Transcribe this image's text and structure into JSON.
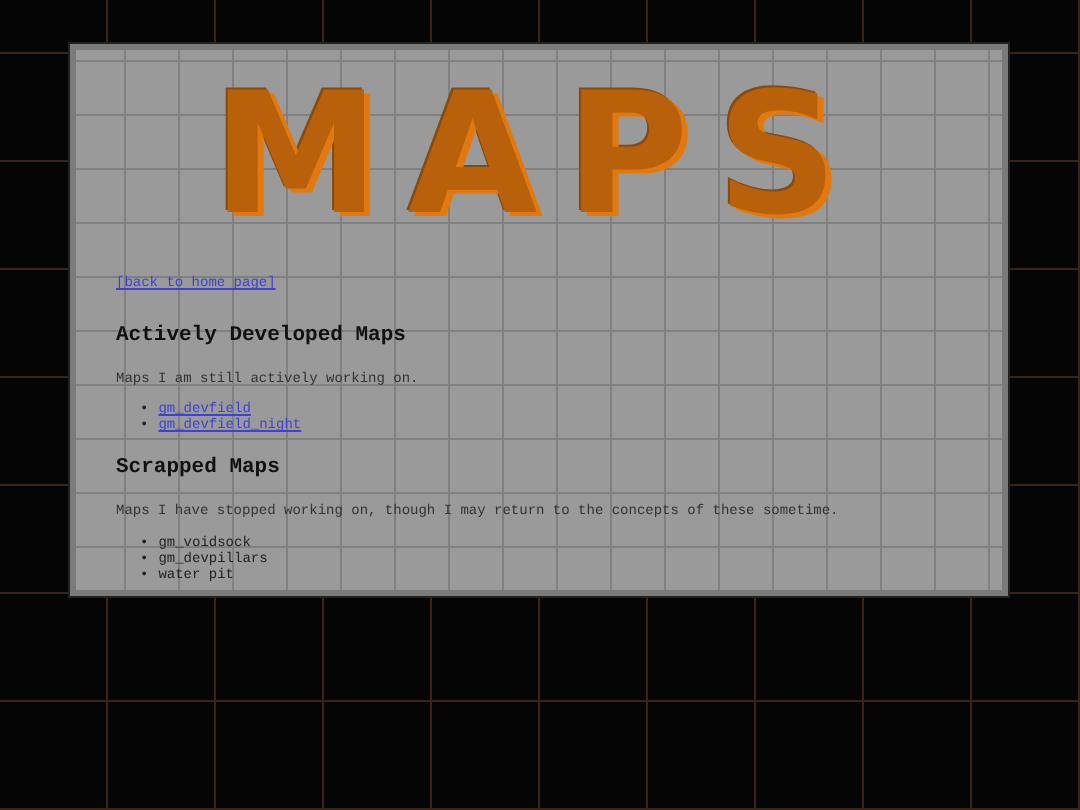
{
  "logo": "MAPS",
  "back_link": "[back to home page]",
  "sections": [
    {
      "heading": "Actively Developed Maps",
      "text": "Maps I am still actively working on.",
      "items": [
        {
          "marker": "•",
          "label": "gm_devfield",
          "kind": "link"
        },
        {
          "marker": "•",
          "label": "gm_devfield_night",
          "kind": "link"
        }
      ]
    },
    {
      "heading": "Scrapped Maps",
      "text": "Maps I have stopped working on, though I may return to the concepts of these sometime.",
      "items": [
        {
          "marker": "•",
          "label": "gm_voidsock",
          "kind": "plain"
        },
        {
          "marker": "•",
          "label": "gm_devpillars",
          "kind": "plain"
        },
        {
          "marker": "•",
          "label": "water pit",
          "kind": "plain"
        }
      ]
    }
  ]
}
